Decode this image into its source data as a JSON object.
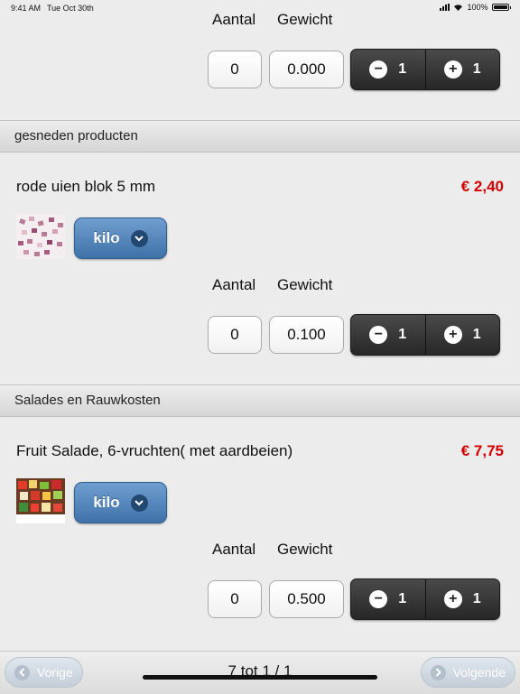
{
  "status_bar": {
    "time": "9:41 AM",
    "date": "Tue Oct 30th",
    "battery": "100%"
  },
  "column_labels": {
    "quantity": "Aantal",
    "weight": "Gewicht"
  },
  "top_item": {
    "quantity": "0",
    "weight": "0.000",
    "minus_label": "1",
    "plus_label": "1"
  },
  "sections": [
    {
      "header": "gesneden producten",
      "product": {
        "name": "rode uien blok 5 mm",
        "price": "€ 2,40",
        "unit": "kilo",
        "quantity": "0",
        "weight": "0.100",
        "minus_label": "1",
        "plus_label": "1"
      }
    },
    {
      "header": "Salades en Rauwkosten",
      "product": {
        "name": "Fruit Salade, 6-vruchten( met aardbeien)",
        "price": "€ 7,75",
        "unit": "kilo",
        "quantity": "0",
        "weight": "0.500",
        "minus_label": "1",
        "plus_label": "1"
      }
    }
  ],
  "footer": {
    "prev_label": "Vorige",
    "next_label": "Volgende",
    "page_info": "7 tot  1 / 1"
  },
  "colors": {
    "price": "#d40000",
    "unit_button": "#4a7db3",
    "stepper": "#333333"
  }
}
